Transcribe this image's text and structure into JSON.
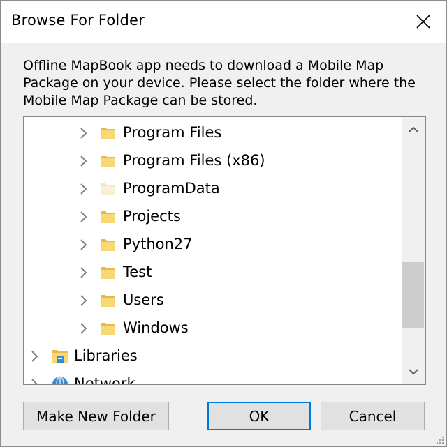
{
  "dialog": {
    "title": "Browse For Folder",
    "description": "Offline MapBook app needs to download a Mobile Map Package on your device. Please select the folder where the Mobile Map Package can be stored."
  },
  "tree": {
    "items": [
      {
        "label": "Program Files",
        "icon": "folder-icon"
      },
      {
        "label": "Program Files (x86)",
        "icon": "folder-icon"
      },
      {
        "label": "ProgramData",
        "icon": "folder-hidden-icon"
      },
      {
        "label": "Projects",
        "icon": "folder-icon"
      },
      {
        "label": "Python27",
        "icon": "folder-icon"
      },
      {
        "label": "Test",
        "icon": "folder-icon"
      },
      {
        "label": "Users",
        "icon": "folder-icon"
      },
      {
        "label": "Windows",
        "icon": "folder-icon"
      },
      {
        "label": "Libraries",
        "icon": "libraries-icon"
      },
      {
        "label": "Network",
        "icon": "network-icon"
      }
    ]
  },
  "buttons": {
    "make_new_folder": "Make New Folder",
    "ok": "OK",
    "cancel": "Cancel"
  },
  "colors": {
    "accent": "#0078d7",
    "folder": "#f8d775",
    "dialog_bg": "#f0f0f0"
  }
}
